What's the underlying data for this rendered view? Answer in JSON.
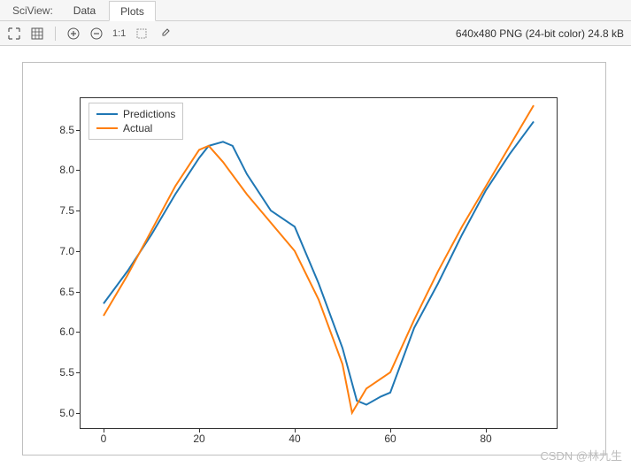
{
  "tabbar": {
    "title": "SciView:",
    "tabs": [
      "Data",
      "Plots"
    ],
    "active": 1
  },
  "toolbar": {
    "icons": [
      "fit-icon",
      "grid-icon",
      "zoom-in-icon",
      "zoom-out-icon",
      "one-to-one",
      "selection-icon",
      "eyedropper-icon"
    ],
    "one_to_one_label": "1:1",
    "status": "640x480 PNG (24-bit color) 24.8 kB"
  },
  "legend": {
    "items": [
      {
        "label": "Predictions",
        "color": "#1f77b4"
      },
      {
        "label": "Actual",
        "color": "#ff7f0e"
      }
    ]
  },
  "xticks": [
    0,
    20,
    40,
    60,
    80
  ],
  "yticks": [
    5.0,
    5.5,
    6.0,
    6.5,
    7.0,
    7.5,
    8.0,
    8.5
  ],
  "watermark": "CSDN @林九生",
  "chart_data": {
    "type": "line",
    "xlabel": "",
    "ylabel": "",
    "xlim": [
      -5,
      95
    ],
    "ylim": [
      4.8,
      8.9
    ],
    "series": [
      {
        "name": "Predictions",
        "color": "#1f77b4",
        "x": [
          0,
          5,
          10,
          15,
          20,
          22,
          25,
          27,
          30,
          35,
          40,
          45,
          50,
          53,
          55,
          58,
          60,
          65,
          70,
          75,
          80,
          85,
          90
        ],
        "y": [
          6.35,
          6.75,
          7.2,
          7.7,
          8.15,
          8.3,
          8.35,
          8.3,
          7.95,
          7.5,
          7.3,
          6.6,
          5.8,
          5.15,
          5.1,
          5.2,
          5.25,
          6.05,
          6.6,
          7.2,
          7.75,
          8.2,
          8.6
        ]
      },
      {
        "name": "Actual",
        "color": "#ff7f0e",
        "x": [
          0,
          5,
          10,
          15,
          20,
          22,
          25,
          30,
          35,
          40,
          45,
          50,
          52,
          55,
          60,
          65,
          70,
          75,
          80,
          85,
          90
        ],
        "y": [
          6.2,
          6.7,
          7.25,
          7.8,
          8.25,
          8.3,
          8.1,
          7.7,
          7.35,
          7.0,
          6.4,
          5.6,
          5.0,
          5.3,
          5.5,
          6.15,
          6.75,
          7.3,
          7.8,
          8.3,
          8.8
        ]
      }
    ]
  }
}
